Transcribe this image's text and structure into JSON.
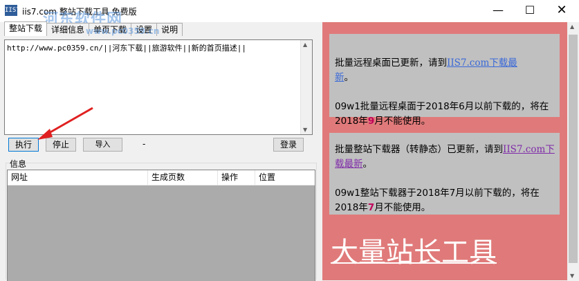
{
  "window": {
    "title": "iis7.com 整站下载工具 免费版",
    "icon_text": "IIS7",
    "watermark": "河东软件网",
    "watermark_url": "www.pc0359.cn",
    "controls": {
      "minimize": "—",
      "maximize": "☐",
      "close": "✕"
    }
  },
  "tabs": [
    {
      "label": "整站下载",
      "active": true
    },
    {
      "label": "详细信息",
      "active": false
    },
    {
      "label": "单页下载",
      "active": false
    },
    {
      "label": "设置",
      "active": false
    },
    {
      "label": "说明",
      "active": false
    }
  ],
  "url_input": {
    "value": "http://www.pc0359.cn/||河东下载||旅游软件||新的首页描述||"
  },
  "buttons": {
    "execute": "执行",
    "stop": "停止",
    "import": "导入",
    "status": "-",
    "login": "登录"
  },
  "info": {
    "label": "信息",
    "columns": [
      "网址",
      "生成页数",
      "操作",
      "位置"
    ]
  },
  "panel": {
    "box1": {
      "line1_prefix": "批量远程桌面已更新，请到",
      "link_a": "IIS7.com下载最",
      "link_b": "新",
      "line1_suffix": "。",
      "line2_a": "09w1批量远程桌面于2018年6月以前下载的，将在2018年",
      "line2_num": "9",
      "line2_b": "月不能使用。"
    },
    "box2": {
      "line1_prefix": "批量整站下载器（转静态）已更新，请到",
      "link": "IIS7.com下载最新",
      "line1_suffix": "。",
      "line2_a": "09w1整站下载器于2018年7月以前下载的，将在2018年",
      "line2_num": "7",
      "line2_b": "月不能使用。"
    },
    "big_title": "大量站长工具"
  },
  "colors": {
    "panel_bg": "#e07a7a",
    "box_bg": "#c0c0c0",
    "link_blue": "#3a69d8",
    "link_purple": "#7f2aa8",
    "highlight_num": "#c0005a"
  }
}
